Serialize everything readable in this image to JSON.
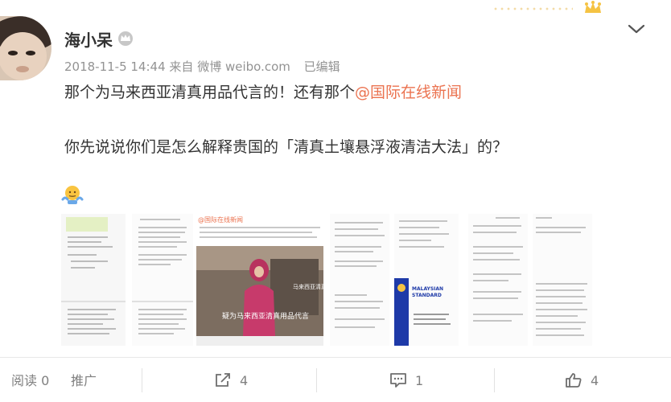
{
  "post": {
    "username": "海小呆",
    "timestamp": "2018-11-5 14:44",
    "source_prefix": "来自",
    "source_name": "微博 weibo.com",
    "edited": "已编辑",
    "text_line1": "那个为马来西亚清真用品代言的！还有那个",
    "mention": "@国际在线新闻",
    "text_line2": "你先说说你们是怎么解释贵国的「清真土壤悬浮液清洁大法」的？"
  },
  "icons": {
    "member": "crown-badge-icon",
    "more": "chevron-down-icon",
    "emoji": "shrug-emoji-icon",
    "share": "share-icon",
    "comment": "comment-icon",
    "like": "thumbs-up-icon"
  },
  "images": {
    "thumb3": {
      "caption": "疑为马来西亚清真用品代言",
      "side_label": "马来西亚清真",
      "header": "@国际在线新闻"
    },
    "thumb5": {
      "title_line1": "MALAYSIAN",
      "title_line2": "STANDARD"
    }
  },
  "footer": {
    "read_label": "阅读",
    "read_count": "0",
    "promote_label": "推广",
    "share_count": "4",
    "comment_count": "1",
    "like_count": "4"
  },
  "colors": {
    "mention": "#eb7350",
    "meta_gray": "#939393",
    "footer_gray": "#808080"
  }
}
